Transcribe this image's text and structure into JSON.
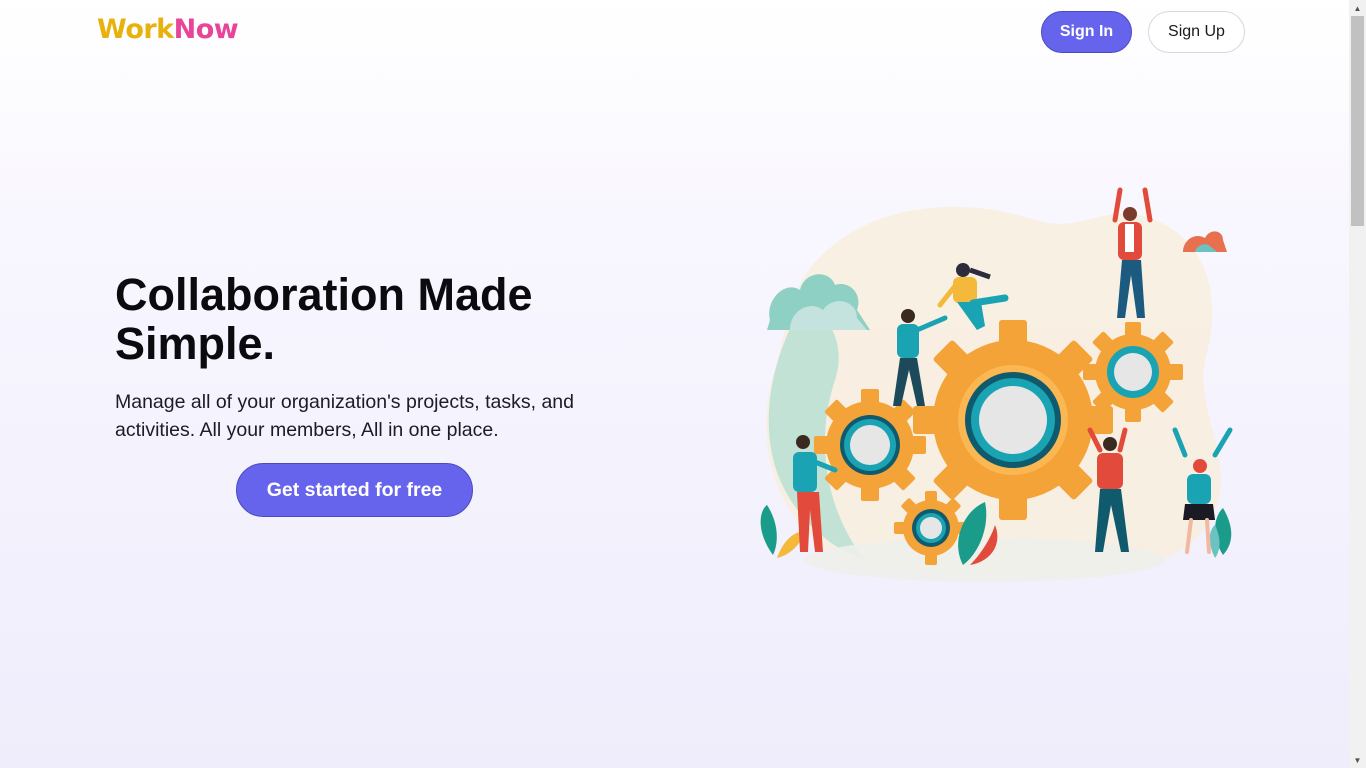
{
  "header": {
    "logo_part1": "Work",
    "logo_part2": "Now",
    "signin_label": "Sign In",
    "signup_label": "Sign Up"
  },
  "hero": {
    "title": "Collaboration Made Simple.",
    "description": "Manage all of your organization's projects, tasks, and activities. All your members, All in one place.",
    "cta_label": "Get started for free"
  },
  "illustration": {
    "icon": "team-gears-illustration"
  },
  "colors": {
    "accent": "#6664ec",
    "logo_yellow": "#e8b20e",
    "logo_pink": "#e8449a"
  }
}
